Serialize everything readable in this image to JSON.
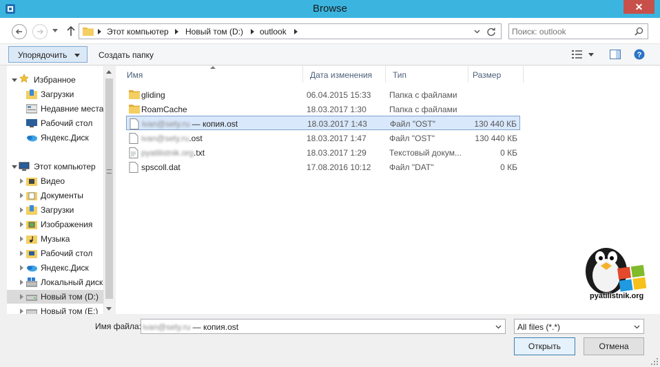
{
  "window": {
    "title": "Browse",
    "close_glyph": "✕"
  },
  "address": {
    "crumbs": [
      "Этот компьютер",
      "Новый том (D:)",
      "outlook"
    ],
    "search_placeholder": "Поиск: outlook"
  },
  "toolbar": {
    "organize_label": "Упорядочить",
    "new_folder_label": "Создать папку"
  },
  "nav": {
    "favorites_label": "Избранное",
    "favorites": [
      {
        "label": "Загрузки",
        "icon": "downloads-folder-icon"
      },
      {
        "label": "Недавние места",
        "icon": "recent-places-icon"
      },
      {
        "label": "Рабочий стол",
        "icon": "desktop-icon"
      },
      {
        "label": "Яндекс.Диск",
        "icon": "yandex-disk-icon"
      }
    ],
    "computer_label": "Этот компьютер",
    "computer": [
      {
        "label": "Видео",
        "icon": "videos-folder-icon"
      },
      {
        "label": "Документы",
        "icon": "documents-folder-icon"
      },
      {
        "label": "Загрузки",
        "icon": "downloads-folder-icon"
      },
      {
        "label": "Изображения",
        "icon": "pictures-folder-icon"
      },
      {
        "label": "Музыка",
        "icon": "music-folder-icon"
      },
      {
        "label": "Рабочий стол",
        "icon": "desktop-folder-icon"
      },
      {
        "label": "Яндекс.Диск",
        "icon": "yandex-disk-icon"
      },
      {
        "label": "Локальный диск",
        "icon": "local-disk-icon"
      },
      {
        "label": "Новый том (D:)",
        "icon": "drive-icon"
      },
      {
        "label": "Новый том (E:)",
        "icon": "drive-icon"
      }
    ]
  },
  "columns": {
    "name": "Имя",
    "date": "Дата изменения",
    "type": "Тип",
    "size": "Размер"
  },
  "files": [
    {
      "name": "gliding",
      "redacted": "",
      "date": "06.04.2015 15:33",
      "type": "Папка с файлами",
      "size": "",
      "icon": "folder-icon"
    },
    {
      "name": "RoamCache",
      "redacted": "",
      "date": "18.03.2017 1:30",
      "type": "Папка с файлами",
      "size": "",
      "icon": "folder-icon"
    },
    {
      "name": " — копия.ost",
      "redacted": "ivan@sety.ru",
      "date": "18.03.2017 1:43",
      "type": "Файл \"OST\"",
      "size": "130 440 КБ",
      "icon": "file-icon"
    },
    {
      "name": ".ost",
      "redacted": "ivan@sety.ru",
      "date": "18.03.2017 1:47",
      "type": "Файл \"OST\"",
      "size": "130 440 КБ",
      "icon": "file-icon"
    },
    {
      "name": ".txt",
      "redacted": "pyatilistnik.org",
      "date": "18.03.2017 1:29",
      "type": "Текстовый докум...",
      "size": "0 КБ",
      "icon": "text-file-icon"
    },
    {
      "name": "spscoll.dat",
      "redacted": "",
      "date": "17.08.2016 10:12",
      "type": "Файл \"DAT\"",
      "size": "0 КБ",
      "icon": "file-icon"
    }
  ],
  "footer": {
    "filename_label": "Имя файла:",
    "filename_redacted": "ivan@sety.ru",
    "filename_value": " — копия.ost",
    "filter_value": "All files (*.*)",
    "open_label": "Открыть",
    "cancel_label": "Отмена"
  },
  "logo": {
    "text": "pyatilistnik.org"
  },
  "colors": {
    "titlebar": "#3bb5df",
    "selection": "#d9e8fb",
    "close": "#c7504a"
  }
}
